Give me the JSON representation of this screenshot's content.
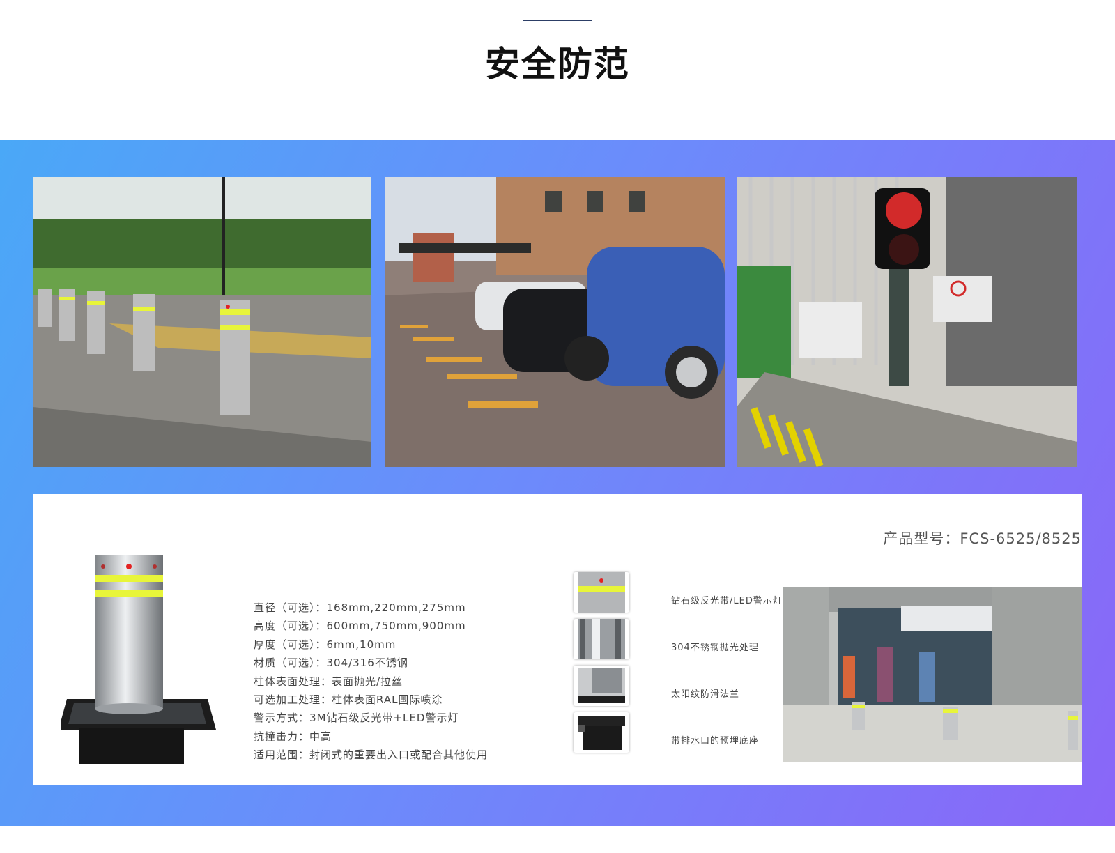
{
  "page": {
    "title": "安全防范"
  },
  "spec": {
    "model": "产品型号：FCS-6525/8525",
    "items": [
      "直径（可选）：168mm,220mm,275mm",
      "高度（可选）：600mm,750mm,900mm",
      "厚度（可选）：6mm,10mm",
      "材质（可选）：304/316不锈钢",
      "柱体表面处理：表面抛光/拉丝",
      "可选加工处理：柱体表面RAL国际喷涂",
      "警示方式：3M钻石级反光带+LED警示灯",
      "抗撞击力：中高",
      "适用范围：封闭式的重要出入口或配合其他使用"
    ],
    "features": [
      {
        "label": "钻石级反光带/LED警示灯",
        "icon": "reflective-band-led-icon"
      },
      {
        "label": "304不锈钢抛光处理",
        "icon": "polished-steel-icon"
      },
      {
        "label": "太阳纹防滑法兰",
        "icon": "anti-slip-flange-icon"
      },
      {
        "label": "带排水口的预埋底座",
        "icon": "embedded-base-icon"
      }
    ]
  },
  "colors": {
    "band_start": "#4aa8f7",
    "band_end": "#8a66f8",
    "reflective_band": "#e8f53a",
    "led": "#e32222"
  }
}
